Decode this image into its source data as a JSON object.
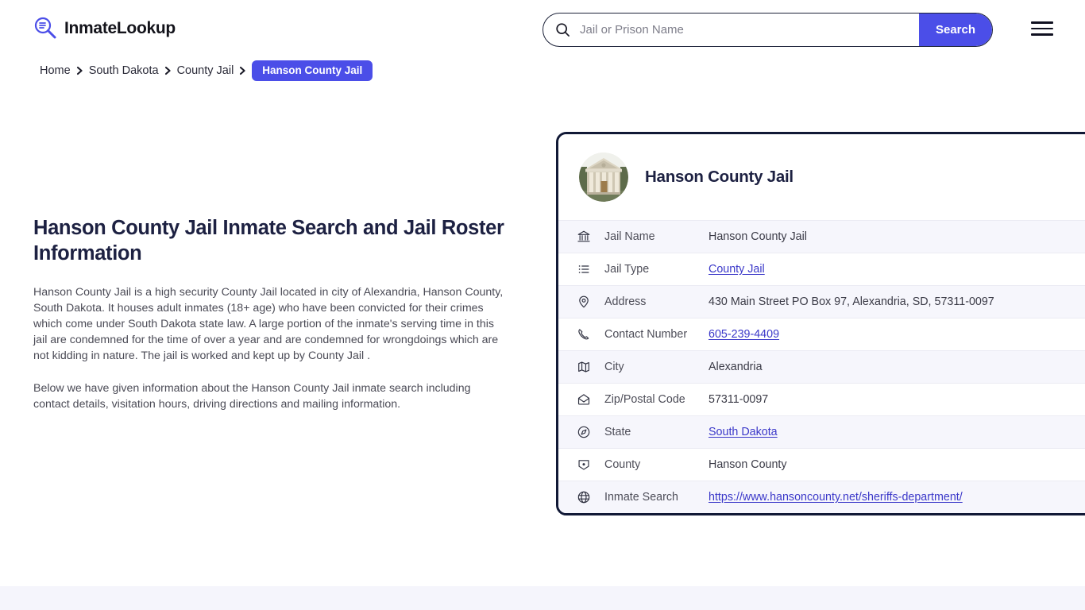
{
  "header": {
    "brand_name": "InmateLookup",
    "brand_icon": "magnifier-list-icon",
    "search": {
      "icon": "search-icon",
      "placeholder": "Jail or Prison Name",
      "value": "",
      "button_label": "Search"
    },
    "menu_icon": "hamburger-menu-icon",
    "accent_color": "#4b4ee8"
  },
  "breadcrumb": {
    "items": [
      {
        "label": "Home",
        "current": false
      },
      {
        "label": "South Dakota",
        "current": false
      },
      {
        "label": "County Jail",
        "current": false
      },
      {
        "label": "Hanson County Jail",
        "current": true
      }
    ],
    "separator_icon": "chevron-right-icon"
  },
  "main": {
    "page_title": "Hanson County Jail Inmate Search and Jail Roster Information",
    "paragraph_1": "Hanson County Jail is a high security County Jail located in city of Alexandria, Hanson County, South Dakota. It houses adult inmates (18+ age) who have been convicted for their crimes which come under South Dakota state law. A large portion of the inmate's serving time in this jail are condemned for the time of over a year and are condemned for wrongdoings which are not kidding in nature. The jail is worked and kept up by County Jail .",
    "paragraph_2": "Below we have given information about the Hanson County Jail inmate search including contact details, visitation hours, driving directions and mailing information."
  },
  "card": {
    "avatar_icon": "courthouse-building-photo",
    "title": "Hanson County Jail",
    "border_color": "#111936",
    "rows": [
      {
        "icon": "bank-icon",
        "label": "Jail Name",
        "value": "Hanson County Jail",
        "link": false
      },
      {
        "icon": "list-icon",
        "label": "Jail Type",
        "value": "County Jail",
        "link": true
      },
      {
        "icon": "map-pin-icon",
        "label": "Address",
        "value": "430 Main Street PO Box 97, Alexandria, SD, 57311-0097",
        "link": false
      },
      {
        "icon": "phone-icon",
        "label": "Contact Number",
        "value": "605-239-4409",
        "link": true
      },
      {
        "icon": "map-icon",
        "label": "City",
        "value": "Alexandria",
        "link": false
      },
      {
        "icon": "envelope-icon",
        "label": "Zip/Postal Code",
        "value": "57311-0097",
        "link": false
      },
      {
        "icon": "compass-icon",
        "label": "State",
        "value": "South Dakota",
        "link": true
      },
      {
        "icon": "county-icon",
        "label": "County",
        "value": "Hanson County",
        "link": false
      },
      {
        "icon": "globe-icon",
        "label": "Inmate Search",
        "value": "https://www.hansoncounty.net/sheriffs-department/",
        "link": true
      }
    ]
  },
  "footer": {
    "band_color": "#f5f5fc"
  }
}
